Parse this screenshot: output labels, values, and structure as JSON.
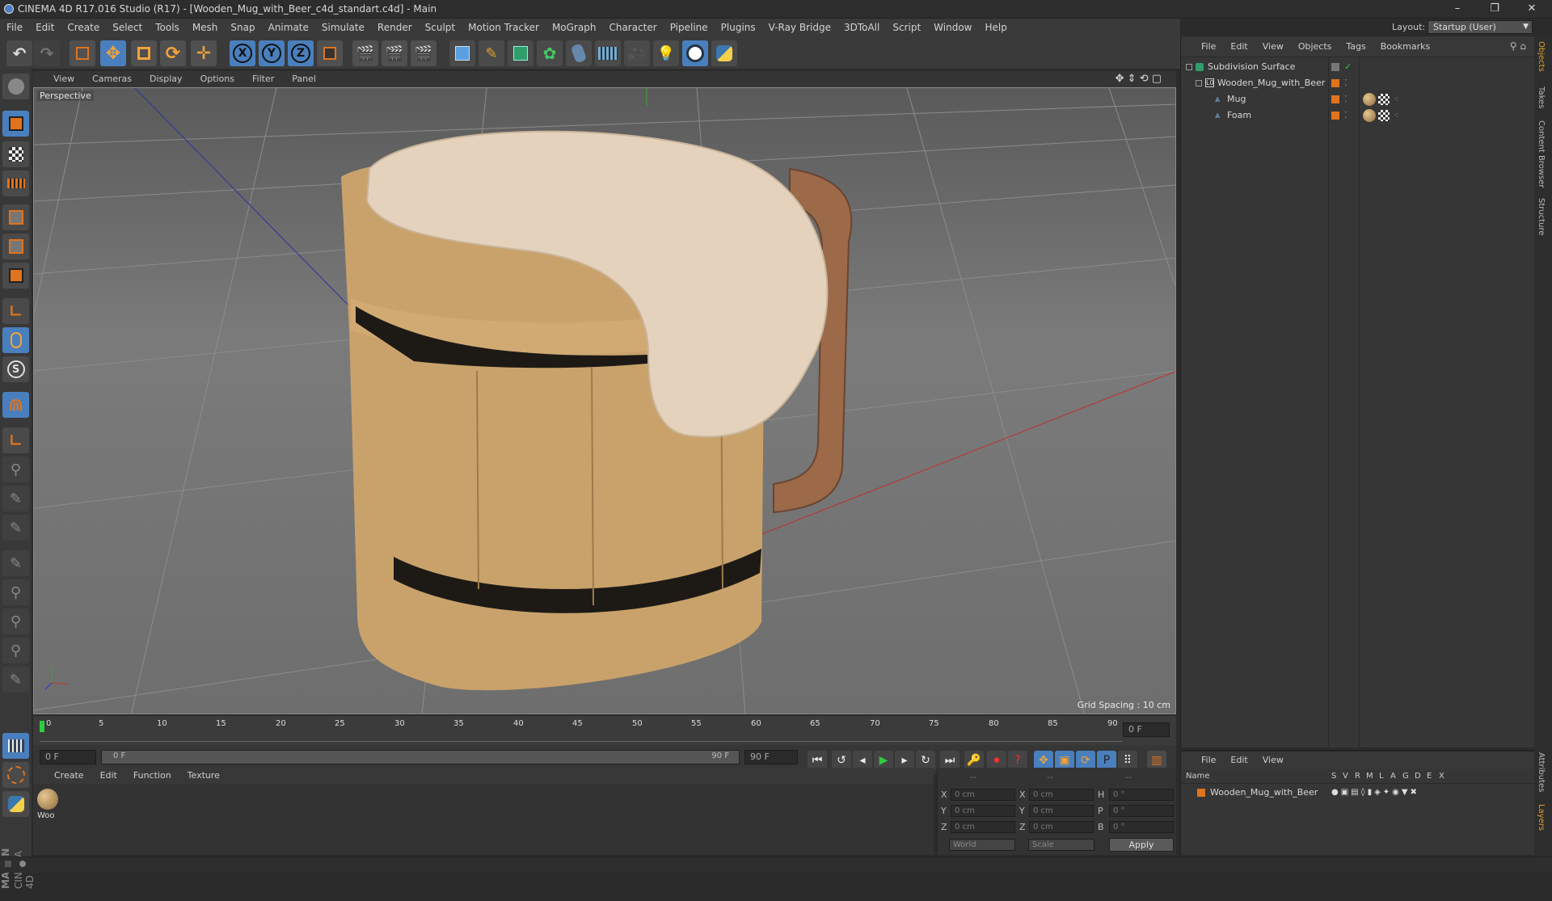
{
  "window": {
    "title": "CINEMA 4D R17.016 Studio (R17) - [Wooden_Mug_with_Beer_c4d_standart.c4d] - Main",
    "minimize": "–",
    "restore": "❐",
    "close": "✕"
  },
  "menu": [
    "File",
    "Edit",
    "Create",
    "Select",
    "Tools",
    "Mesh",
    "Snap",
    "Animate",
    "Simulate",
    "Render",
    "Sculpt",
    "Motion Tracker",
    "MoGraph",
    "Character",
    "Pipeline",
    "Plugins",
    "V-Ray Bridge",
    "3DToAll",
    "Script",
    "Window",
    "Help"
  ],
  "layout": {
    "label": "Layout:",
    "value": "Startup (User)"
  },
  "viewport": {
    "menu": [
      "View",
      "Cameras",
      "Display",
      "Options",
      "Filter",
      "Panel"
    ],
    "label": "Perspective",
    "grid": "Grid Spacing : 10 cm"
  },
  "timeline": {
    "ticks": [
      "0",
      "5",
      "10",
      "15",
      "20",
      "25",
      "30",
      "35",
      "40",
      "45",
      "50",
      "55",
      "60",
      "65",
      "70",
      "75",
      "80",
      "85",
      "90"
    ],
    "frame": "0 F",
    "start": "0 F",
    "slider_start": "0 F",
    "slider_end": "90 F",
    "end": "90 F"
  },
  "material": {
    "menu": [
      "Create",
      "Edit",
      "Function",
      "Texture"
    ],
    "name": "Woo"
  },
  "coords": {
    "header": [
      "--",
      "--",
      "--"
    ],
    "rows": [
      {
        "a": "X",
        "v1": "0 cm",
        "b": "X",
        "v2": "0 cm",
        "c": "H",
        "v3": "0 °"
      },
      {
        "a": "Y",
        "v1": "0 cm",
        "b": "Y",
        "v2": "0 cm",
        "c": "P",
        "v3": "0 °"
      },
      {
        "a": "Z",
        "v1": "0 cm",
        "b": "Z",
        "v2": "0 cm",
        "c": "B",
        "v3": "0 °"
      }
    ],
    "world": "World",
    "scale": "Scale",
    "apply": "Apply"
  },
  "objects": {
    "menu": [
      "File",
      "Edit",
      "View",
      "Objects",
      "Tags",
      "Bookmarks"
    ],
    "items": [
      {
        "name": "Subdivision Surface"
      },
      {
        "name": "Wooden_Mug_with_Beer"
      },
      {
        "name": "Mug"
      },
      {
        "name": "Foam"
      }
    ]
  },
  "layers": {
    "menu": [
      "File",
      "Edit",
      "View"
    ],
    "cols": [
      "Name",
      "S",
      "V",
      "R",
      "M",
      "L",
      "A",
      "G",
      "D",
      "E",
      "X"
    ],
    "row": "Wooden_Mug_with_Beer"
  },
  "sidetabs": [
    "Objects",
    "Takes",
    "Content Browser",
    "Structure",
    "Attributes",
    "Layers"
  ],
  "brand": {
    "a": "MAXON",
    "b": "CINEMA 4D"
  },
  "colors": {
    "accent": "#4a7fbd",
    "orange": "#e0731c",
    "panel": "#363636"
  }
}
